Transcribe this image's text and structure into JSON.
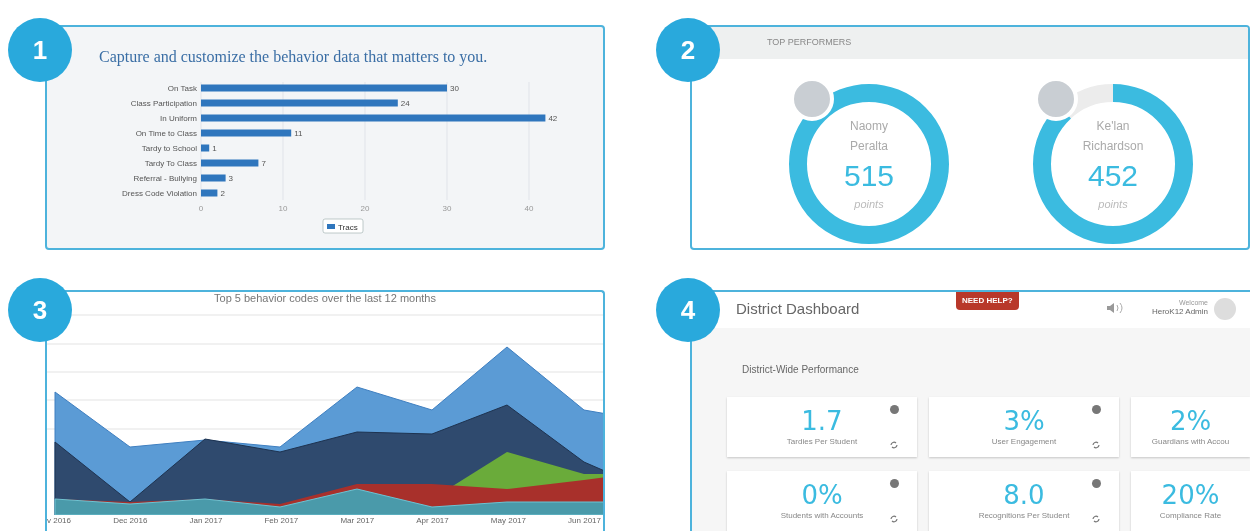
{
  "behavior_panel": {
    "badge": "1",
    "title": "Capture and customize the behavior data that matters to you.",
    "chart_data": {
      "type": "bar",
      "orientation": "horizontal",
      "categories": [
        "On Task",
        "Class Participation",
        "In Uniform",
        "On Time to Class",
        "Tardy to School",
        "Tardy To Class",
        "Referral - Bullying",
        "Dress Code Violation"
      ],
      "series": [
        {
          "name": "Tracs",
          "color": "#2f76bd",
          "values": [
            30,
            24,
            42,
            11,
            1,
            7,
            3,
            2
          ]
        }
      ],
      "xlim": [
        0,
        42
      ],
      "xticks": [
        0,
        10,
        20,
        30,
        40
      ],
      "grid": true,
      "data_labels": true
    }
  },
  "performers_panel": {
    "badge": "2",
    "header": "TOP PERFORMERS",
    "performers": [
      {
        "first_name": "Naomy",
        "last_name": "Peralta",
        "score": "515",
        "unit": "points",
        "level": 1.0
      },
      {
        "first_name": "Ke'lan",
        "last_name": "Richardson",
        "score": "452",
        "unit": "points",
        "level": 0.88
      }
    ]
  },
  "trend_panel": {
    "badge": "3",
    "title": "Top 5 behavior codes over the last 12 months",
    "x_labels": [
      "v 2016",
      "Dec 2016",
      "Jan 2017",
      "Feb 2017",
      "Mar 2017",
      "Apr 2017",
      "May 2017",
      "Jun 2017"
    ]
  },
  "dashboard_panel": {
    "badge": "4",
    "title": "District Dashboard",
    "help_button": "NEED HELP?",
    "welcome": "Welcome",
    "user": "HeroK12 Admin",
    "section": "District-Wide Performance",
    "cards": [
      {
        "value": "1.7",
        "label": "Tardies Per Student",
        "icons": true
      },
      {
        "value": "3%",
        "label": "User Engagement",
        "icons": true
      },
      {
        "value": "2%",
        "label": "Guardians with Accou",
        "icons": false
      },
      {
        "value": "0%",
        "label": "Students with Accounts",
        "icons": true
      },
      {
        "value": "8.0",
        "label": "Recognitions Per Student",
        "icons": true
      },
      {
        "value": "20%",
        "label": "Compliance Rate",
        "icons": false
      }
    ]
  }
}
